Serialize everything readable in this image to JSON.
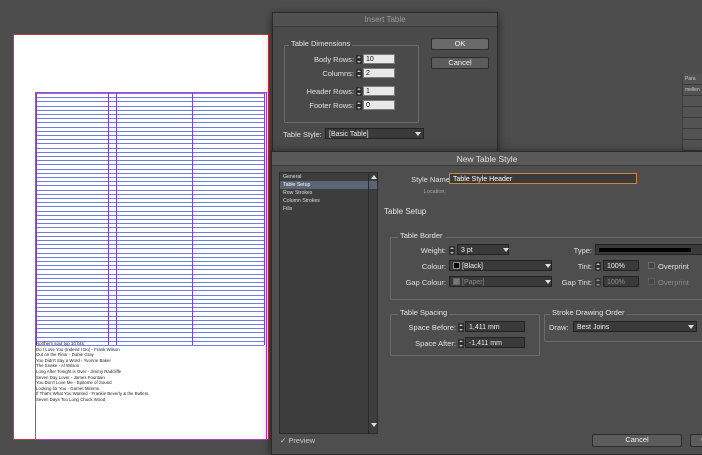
{
  "document": {
    "song_lines": [
      "Northern soul top 10 hits:",
      "Do I Love You (Indeed I Do) - Frank Wilson",
      "Out on the Floor - Dobie Gray",
      "You Didn't Say a Word - Yvonne Baker",
      "The Snake - Al Wilson",
      "Long After Tonight is Over - Jimmy Radcliffe",
      "Seven Day Lover - James Fountain",
      "You Don't Love Me - Epitome of Sound",
      "Looking for You - Garnet Mimms",
      "If That's What You Wanted - Frankie Beverly & the Butlers",
      "Seven Days Too Long Chuck Wood"
    ]
  },
  "background_panel": {
    "header": "Para",
    "first_row": "mellen"
  },
  "insert_table": {
    "title": "Insert Table",
    "dimensions_legend": "Table Dimensions",
    "body_rows_label": "Body Rows:",
    "body_rows_value": "10",
    "columns_label": "Columns:",
    "columns_value": "2",
    "header_rows_label": "Header Rows:",
    "header_rows_value": "1",
    "footer_rows_label": "Footer Rows:",
    "footer_rows_value": "0",
    "table_style_label": "Table Style:",
    "table_style_value": "[Basic Table]",
    "ok_label": "OK",
    "cancel_label": "Cancel"
  },
  "new_table_style": {
    "title": "New Table Style",
    "categories": [
      "General",
      "Table Setup",
      "Row Strokes",
      "Column Strokes",
      "Fills"
    ],
    "selected_category": "Table Setup",
    "style_name_label": "Style Name:",
    "style_name_value": "Table Style Header",
    "location_label": "Location:",
    "section_heading": "Table Setup",
    "border_legend": "Table Border",
    "weight_label": "Weight:",
    "weight_value": "3 pt",
    "type_label": "Type:",
    "colour_label": "Colour:",
    "colour_value": "[Black]",
    "tint_label": "Tint:",
    "tint_value": "100%",
    "overprint_label": "Overprint",
    "gap_colour_label": "Gap Colour:",
    "gap_colour_value": "[Paper]",
    "gap_tint_label": "Gap Tint:",
    "gap_tint_value": "100%",
    "gap_overprint_label": "Overprint",
    "spacing_legend": "Table Spacing",
    "space_before_label": "Space Before:",
    "space_before_value": "1,411 mm",
    "space_after_label": "Space After:",
    "space_after_value": "-1,411 mm",
    "stroke_order_legend": "Stroke Drawing Order",
    "draw_label": "Draw:",
    "draw_value": "Best Joins",
    "preview_label": "Preview",
    "cancel_label": "Cancel",
    "ok_label": "Ol"
  },
  "colors": {
    "app_bg": "#4d4d4d",
    "dialog_bg": "#4e4e4e",
    "row_line": "#6f7fe0",
    "column_line": "#7a47c8",
    "margin_guide": "#c23ac7",
    "style_name_border": "#c98a3a",
    "selection": "#596475"
  }
}
